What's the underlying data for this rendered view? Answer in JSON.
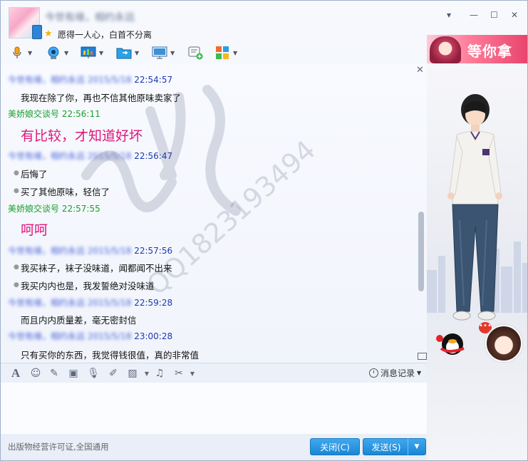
{
  "header": {
    "contact_name": "今世有缘，相约永远",
    "signature": "愿得一人心，白首不分离"
  },
  "banner": {
    "text": "等你拿"
  },
  "chat": {
    "messages": [
      {
        "sender": "今世有缘，相约永远 2015/5/18",
        "time": "22:54:57",
        "sender_color": "blue",
        "text": "我现在除了你，再也不信其他原味卖家了"
      },
      {
        "sender": "美娇娘交谈号",
        "time": "22:56:11",
        "sender_color": "green",
        "big_text": "有比较，才知道好坏"
      },
      {
        "sender": "今世有缘，相约永远 2015/5/18",
        "time": "22:56:47",
        "sender_color": "blue",
        "lines": [
          "后悔了",
          "买了其他原味，轻信了"
        ]
      },
      {
        "sender": "美娇娘交谈号",
        "time": "22:57:55",
        "sender_color": "green",
        "big_text": "呵呵"
      },
      {
        "sender": "今世有缘，相约永远 2015/5/18",
        "time": "22:57:56",
        "sender_color": "blue",
        "lines": [
          "我买袜子，袜子没味道，闻都闻不出来",
          "我买内内也是，我发誓绝对没味道"
        ]
      },
      {
        "sender": "今世有缘，相约永远 2015/5/18",
        "time": "22:59:28",
        "sender_color": "blue",
        "text": "而且内内质量差，毫无密封信"
      },
      {
        "sender": "今世有缘，相约永远 2015/5/18",
        "time": "23:00:28",
        "sender_color": "blue",
        "text": "只有买你的东西，我觉得钱很值，真的非常值"
      }
    ]
  },
  "watermark": {
    "text": "QQ1823193494"
  },
  "input_toolbar": {
    "history_label": "消息记录"
  },
  "footer": {
    "notice": "出版物经营许可证,全国通用",
    "close_label": "关闭(C)",
    "send_label": "发送(S)"
  },
  "colors": {
    "accent": "#1b86d6",
    "time_blue": "#1c38b4",
    "sender_green": "#17a12b",
    "pink": "#e0147a"
  }
}
